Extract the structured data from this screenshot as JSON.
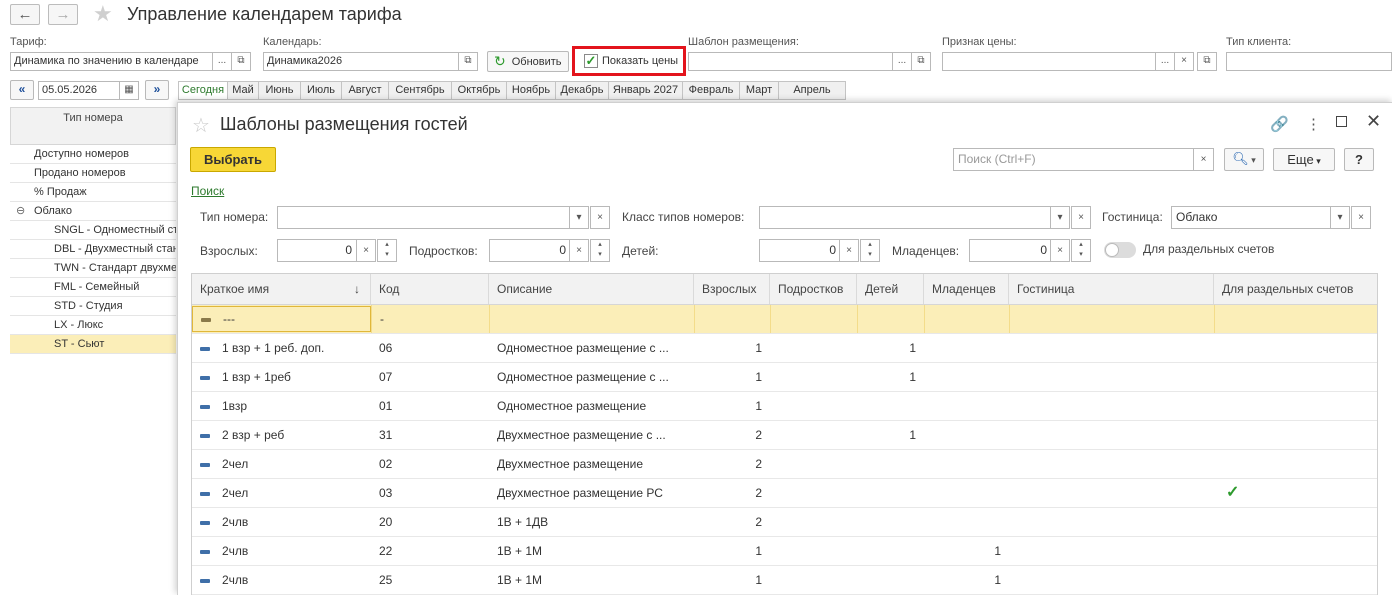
{
  "window": {
    "title": "Управление календарем тарифа"
  },
  "filters": {
    "tariff_label": "Тариф:",
    "tariff_value": "Динамика по значению в календаре",
    "calendar_label": "Календарь:",
    "calendar_value": "Динамика2026",
    "refresh_label": "Обновить",
    "show_prices_label": "Показать цены",
    "template_label": "Шаблон размещения:",
    "price_sign_label": "Признак цены:",
    "client_type_label": "Тип клиента:",
    "date_value": "05.05.2026"
  },
  "months": [
    "Сегодня",
    "Май",
    "Июнь",
    "Июль",
    "Август",
    "Сентябрь",
    "Октябрь",
    "Ноябрь",
    "Декабрь",
    "Январь 2027",
    "Февраль",
    "Март",
    "Апрель"
  ],
  "left_panel": {
    "header": "Тип номера",
    "rows": [
      "Доступно номеров",
      "Продано номеров",
      "% Продаж",
      "Облако",
      "SNGL - Одноместный ст",
      "DBL - Двухместный стан",
      "TWN - Стандарт двухме",
      "FML - Семейный",
      "STD - Студия",
      "LX - Люкс",
      "ST - Сьют"
    ]
  },
  "modal": {
    "title": "Шаблоны размещения гостей",
    "select_label": "Выбрать",
    "search_placeholder": "Поиск (Ctrl+F)",
    "more_label": "Еще",
    "help_label": "?",
    "search_link": "Поиск",
    "room_type_label": "Тип номера:",
    "room_class_label": "Класс типов номеров:",
    "hotel_label": "Гостиница:",
    "hotel_value": "Облако",
    "adults_label": "Взрослых:",
    "adults_value": "0",
    "teens_label": "Подростков:",
    "teens_value": "0",
    "children_label": "Детей:",
    "children_value": "0",
    "infants_label": "Младенцев:",
    "infants_value": "0",
    "separate_accounts_label": "Для раздельных счетов",
    "columns": [
      "Краткое имя",
      "Код",
      "Описание",
      "Взрослых",
      "Подростков",
      "Детей",
      "Младенцев",
      "Гостиница",
      "Для раздельных счетов"
    ],
    "rows": [
      {
        "name": "---",
        "code": "-",
        "desc": "",
        "adults": "",
        "teens": "",
        "children": "",
        "infants": "",
        "hotel": "",
        "separate": ""
      },
      {
        "name": "1 взр + 1 реб. доп.",
        "code": "06",
        "desc": "Одноместное размещение с ...",
        "adults": "1",
        "teens": "",
        "children": "1",
        "infants": "",
        "hotel": "",
        "separate": ""
      },
      {
        "name": "1 взр + 1реб",
        "code": "07",
        "desc": "Одноместное размещение с ...",
        "adults": "1",
        "teens": "",
        "children": "1",
        "infants": "",
        "hotel": "",
        "separate": ""
      },
      {
        "name": "1взр",
        "code": "01",
        "desc": "Одноместное размещение",
        "adults": "1",
        "teens": "",
        "children": "",
        "infants": "",
        "hotel": "",
        "separate": ""
      },
      {
        "name": "2 взр + реб",
        "code": "31",
        "desc": "Двухместное размещение с ...",
        "adults": "2",
        "teens": "",
        "children": "1",
        "infants": "",
        "hotel": "",
        "separate": ""
      },
      {
        "name": "2чел",
        "code": "02",
        "desc": "Двухместное размещение",
        "adults": "2",
        "teens": "",
        "children": "",
        "infants": "",
        "hotel": "",
        "separate": ""
      },
      {
        "name": "2чел",
        "code": "03",
        "desc": "Двухместное размещение РС",
        "adults": "2",
        "teens": "",
        "children": "",
        "infants": "",
        "hotel": "",
        "separate": "✓"
      },
      {
        "name": "2члв",
        "code": "20",
        "desc": "1В + 1ДВ",
        "adults": "2",
        "teens": "",
        "children": "",
        "infants": "",
        "hotel": "",
        "separate": ""
      },
      {
        "name": "2члв",
        "code": "22",
        "desc": "1В + 1М",
        "adults": "1",
        "teens": "",
        "children": "",
        "infants": "1",
        "hotel": "",
        "separate": ""
      },
      {
        "name": "2члв",
        "code": "25",
        "desc": "1В + 1М",
        "adults": "1",
        "teens": "",
        "children": "",
        "infants": "1",
        "hotel": "",
        "separate": ""
      }
    ]
  },
  "colors": {
    "highlight_row": "#fbeeb8",
    "accent_green": "#2d7a2d",
    "select_button": "#f7d736",
    "red_frame": "#e3141c"
  }
}
